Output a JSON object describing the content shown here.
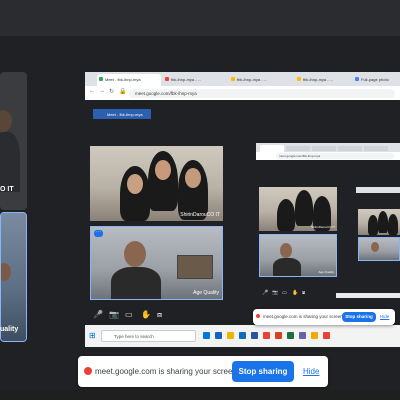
{
  "browser": {
    "tabs": [
      {
        "label": "Meet - fbk-ihnp-mya",
        "color": "#34a853"
      },
      {
        "label": "fbk-ihnp-mya - ...",
        "color": "#ea4335"
      },
      {
        "label": "fbk-ihnp-mya - ...",
        "color": "#fbbc04"
      },
      {
        "label": "fbk-ihnp-mya - ...",
        "color": "#fbbc04"
      },
      {
        "label": "Full-page photo",
        "color": "#4285f4"
      }
    ],
    "url": "meet.google.com/fbk-ihnp-mya",
    "bookmark": "Meet - fbk-ihnp-mya"
  },
  "participants": {
    "left_cut_label": "O IT",
    "left_cut_label2": "uality",
    "group_label": "ShirinDarouCO IT",
    "man_label": "Age Quality"
  },
  "inner": {
    "url": "meet.google.com/fbk-ihnp-mya",
    "group_label": "ShirinDarouCO IT",
    "man_label": "Age Quality"
  },
  "taskbar": {
    "search_placeholder": "Type here to search"
  },
  "banner_small": {
    "text": "meet.google.com is sharing your screen.",
    "stop": "Stop sharing",
    "hide": "Hide"
  },
  "banner_large": {
    "text": "meet.google.com is sharing your screen.",
    "stop": "Stop sharing",
    "hide": "Hide"
  },
  "colors": {
    "accent": "#1a73e8",
    "meet_bg": "#202124",
    "tile_outline": "#8ab4f8"
  }
}
